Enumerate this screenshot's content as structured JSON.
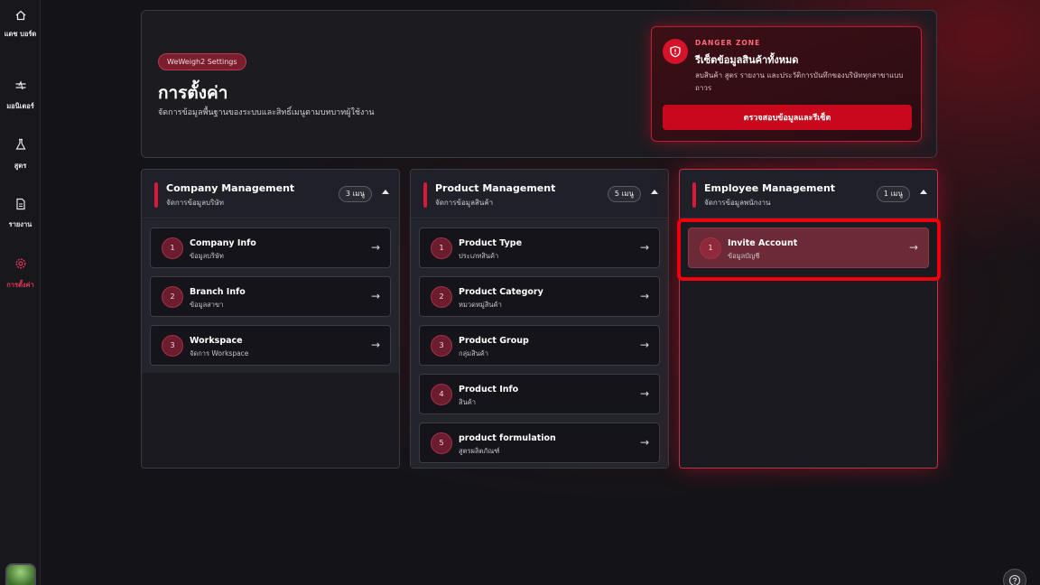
{
  "sidebar": {
    "items": [
      {
        "label": "แดช บอร์ด",
        "icon": "home-icon"
      },
      {
        "label": "มอนิเตอร์",
        "icon": "monitor-icon"
      },
      {
        "label": "สูตร",
        "icon": "flask-icon"
      },
      {
        "label": "รายงาน",
        "icon": "document-icon"
      },
      {
        "label": "การตั้งค่า",
        "icon": "gear-icon",
        "active": true
      }
    ]
  },
  "header": {
    "pill": "WeWeigh2 Settings",
    "title": "การตั้งค่า",
    "subtitle": "จัดการข้อมูลพื้นฐานของระบบและสิทธิ์เมนูตามบทบาทผู้ใช้งาน"
  },
  "danger": {
    "kicker": "DANGER ZONE",
    "title": "รีเซ็ตข้อมูลสินค้าทั้งหมด",
    "description": "ลบสินค้า สูตร รายงาน และประวัติการบันทึกของบริษัททุกสาขาแบบถาวร",
    "button": "ตรวจสอบข้อมูลและรีเซ็ต",
    "accent": "#d4122a"
  },
  "columns": [
    {
      "title": "Company Management",
      "subtitle": "จัดการข้อมูลบริษัท",
      "count": "3 เมนู",
      "items": [
        {
          "num": "1",
          "title": "Company Info",
          "subtitle": "ข้อมูลบริษัท"
        },
        {
          "num": "2",
          "title": "Branch Info",
          "subtitle": "ข้อมูลสาขา"
        },
        {
          "num": "3",
          "title": "Workspace",
          "subtitle": "จัดการ Workspace"
        }
      ]
    },
    {
      "title": "Product Management",
      "subtitle": "จัดการข้อมูลสินค้า",
      "count": "5 เมนู",
      "items": [
        {
          "num": "1",
          "title": "Product Type",
          "subtitle": "ประเภทสินค้า"
        },
        {
          "num": "2",
          "title": "Product Category",
          "subtitle": "หมวดหมู่สินค้า"
        },
        {
          "num": "3",
          "title": "Product Group",
          "subtitle": "กลุ่มสินค้า"
        },
        {
          "num": "4",
          "title": "Product Info",
          "subtitle": "สินค้า"
        },
        {
          "num": "5",
          "title": "product formulation",
          "subtitle": "สูตรผลิตภัณฑ์"
        }
      ]
    },
    {
      "title": "Employee Management",
      "subtitle": "จัดการข้อมูลพนักงาน",
      "count": "1 เมนู",
      "items": [
        {
          "num": "1",
          "title": "Invite Account",
          "subtitle": "ข้อมูลบัญชี"
        }
      ]
    }
  ],
  "arrow": "→",
  "help_icon": "question-icon"
}
